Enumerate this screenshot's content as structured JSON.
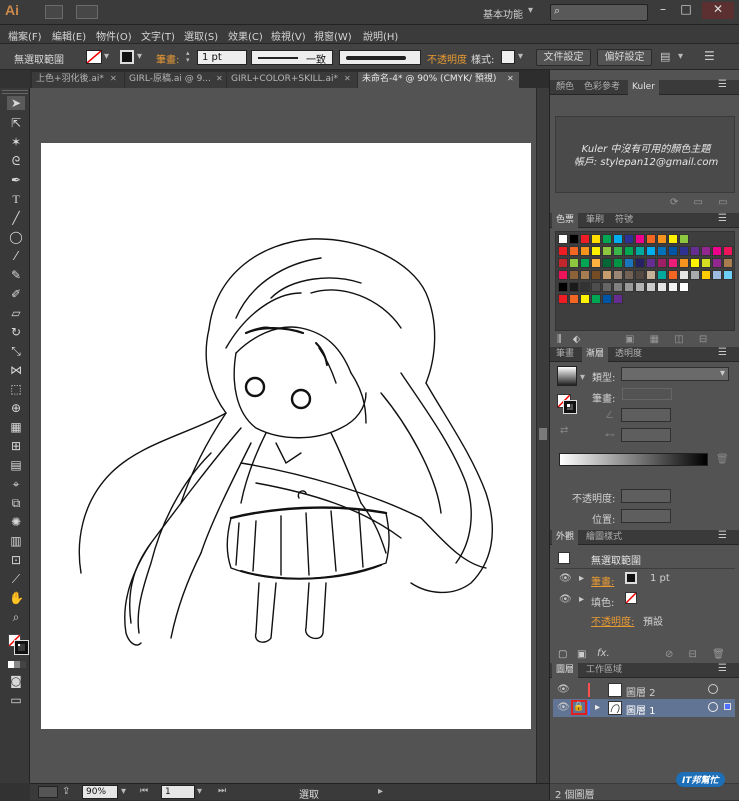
{
  "app": {
    "logo": "Ai",
    "workspace": "基本功能",
    "search_placeholder": "",
    "window_buttons": [
      "–",
      "□",
      "✕"
    ]
  },
  "menu": [
    "檔案(F)",
    "編輯(E)",
    "物件(O)",
    "文字(T)",
    "選取(S)",
    "效果(C)",
    "檢視(V)",
    "視窗(W)",
    "說明(H)"
  ],
  "control": {
    "selection": "無選取範圍",
    "stroke_label": "筆畫:",
    "stroke_value": "1 pt",
    "stroke_profile": "一致",
    "opacity_label": "不透明度",
    "style_label": "樣式:",
    "doc_setup": "文件設定",
    "preferences": "偏好設定"
  },
  "tabs": [
    {
      "label": "上色+羽化後.ai*",
      "close": "✕"
    },
    {
      "label": "GIRL-原稿.ai @ 9...",
      "close": "✕"
    },
    {
      "label": "GIRL+COLOR+SKILL.ai*",
      "close": "✕"
    },
    {
      "label": "未命名-4* @ 90% (CMYK/ 預視)",
      "close": "✕"
    }
  ],
  "kuler": {
    "tabs": [
      "顏色",
      "色彩參考",
      "Kuler"
    ],
    "message": "Kuler 中沒有可用的顏色主題",
    "account": "帳戶: stylepan12@gmail.com"
  },
  "swatches": {
    "tabs": [
      "色票",
      "筆刷",
      "符號"
    ],
    "colors": [
      [
        "#ffffff",
        "#000000",
        "#ee1c24",
        "#ffde00",
        "#00a651",
        "#00aeef",
        "#2e3192",
        "#ec008c",
        "#f26522",
        "#f7941d",
        "#fff200",
        "#8dc63f"
      ],
      [
        "#ee1c24",
        "#f26522",
        "#f7941d",
        "#fff200",
        "#8dc63f",
        "#39b54a",
        "#00a651",
        "#00a99d",
        "#00aeef",
        "#0072bc",
        "#0054a6",
        "#2e3192",
        "#662d91",
        "#92278f",
        "#ec008c",
        "#ed145b"
      ],
      [
        "#c1272d",
        "#8dc63f",
        "#00a651",
        "#fbb040",
        "#006837",
        "#009444",
        "#1b75bc",
        "#262262",
        "#662d91",
        "#9e1f63",
        "#ed1e79",
        "#f7941d",
        "#fff200",
        "#d7df23",
        "#92278f",
        "#a97c50"
      ],
      [
        "#ed145b",
        "#8c6239",
        "#a67c52",
        "#754c24",
        "#c69c6d",
        "#998675",
        "#736357",
        "#534741",
        "#c7b299",
        "#00a99d",
        "#f26522",
        "#e5e5e5",
        "#a7a9ac",
        "#ffcc00",
        "#9dbde0",
        "#6dcff6"
      ],
      [
        "#000000",
        "#1a1a1a",
        "#333333",
        "#4d4d4d",
        "#666666",
        "#808080",
        "#999999",
        "#b3b3b3",
        "#cccccc",
        "#e6e6e6",
        "#f2f2f2",
        "#ffffff"
      ],
      [
        "#ee1c24",
        "#f26522",
        "#fff200",
        "#00a651",
        "#0054a6",
        "#662d91"
      ]
    ]
  },
  "gradient": {
    "tabs": [
      "筆畫",
      "漸層",
      "透明度"
    ],
    "type_label": "類型:",
    "stroke_label": "筆畫:",
    "opacity_label": "不透明度:",
    "position_label": "位置:"
  },
  "appearance": {
    "tabs": [
      "外觀",
      "繪圖樣式"
    ],
    "title": "無選取範圍",
    "stroke_label": "筆畫:",
    "stroke_value": "1 pt",
    "fill_label": "填色:",
    "opacity_label": "不透明度:",
    "opacity_value": "預設",
    "fx": "fx."
  },
  "layers": {
    "tabs": [
      "圖層",
      "工作區域"
    ],
    "items": [
      {
        "name": "圖層 2",
        "color": "#ff4f4f",
        "locked": false,
        "selected": false
      },
      {
        "name": "圖層 1",
        "color": "#4f6fff",
        "locked": true,
        "selected": true
      }
    ],
    "count": "2 個圖層"
  },
  "status": {
    "zoom": "90%",
    "page": "1",
    "tool": "選取"
  },
  "watermark": "IT邦幫忙"
}
